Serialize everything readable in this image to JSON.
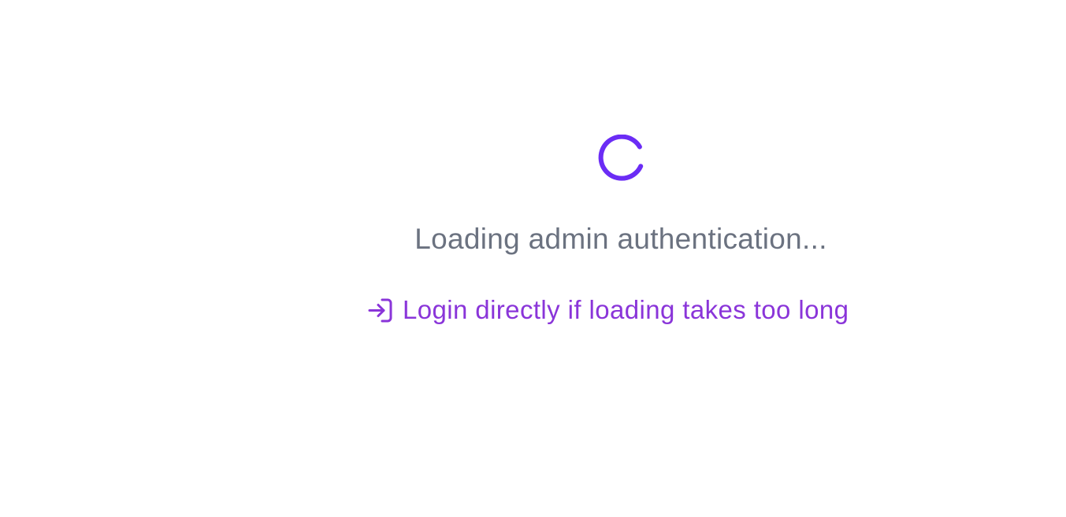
{
  "loading": {
    "message": "Loading admin authentication...",
    "spinner_color": "#6b2cf5",
    "text_color": "#6b7280"
  },
  "login_link": {
    "icon": "login-icon",
    "label": "Login directly if loading takes too long",
    "color": "#8a35d9"
  }
}
